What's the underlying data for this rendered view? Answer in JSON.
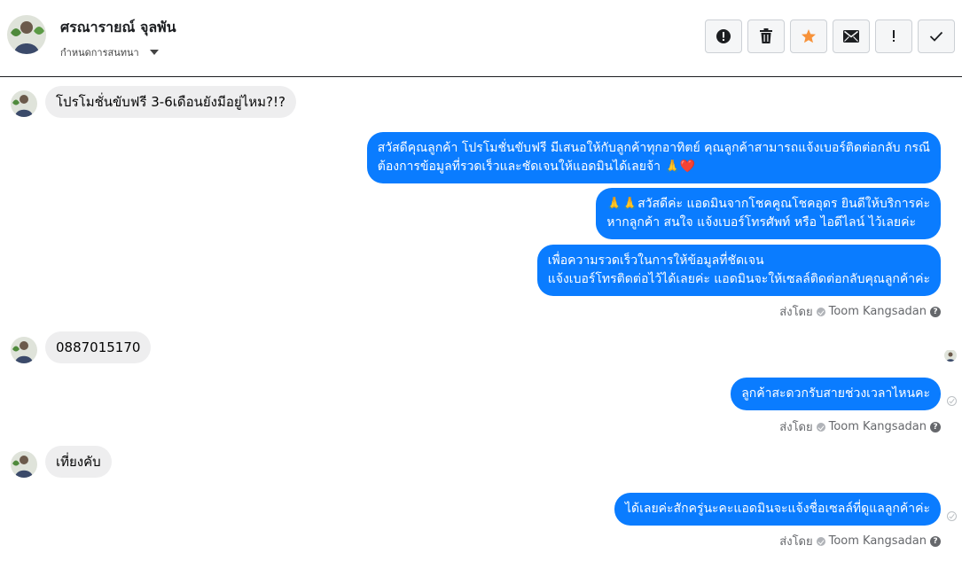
{
  "header": {
    "contact_name": "ศรณารายณ์ จุลพัน",
    "assign_label": "กำหนดการสนทนา",
    "toolbar": [
      {
        "name": "spam-button",
        "icon": "alert-circle-icon"
      },
      {
        "name": "delete-button",
        "icon": "trash-icon"
      },
      {
        "name": "star-button",
        "icon": "star-icon"
      },
      {
        "name": "mark-unread-button",
        "icon": "envelope-icon"
      },
      {
        "name": "follow-up-button",
        "icon": "exclamation-icon"
      },
      {
        "name": "mark-done-button",
        "icon": "checkmark-icon"
      }
    ],
    "accent_star": "#f7923a"
  },
  "messages": {
    "m1": "โปรโมชั่นขับฟรี 3-6เดือนยังมีอยู่ไหม?!?",
    "m2": [
      "สวัสดีคุณลูกค้า โปรโมชั่นขับฟรี มีเสนอให้กับลูกค้าทุกอาทิตย์ คุณลูกค้าสามารถแจ้งเบอร์ติดต่อกลับ กรณี",
      "ต้องการข้อมูลที่รวดเร็วและชัดเจนให้แอดมินได้เลยจ้า 🙏❤️"
    ],
    "m3": [
      "🙏🙏สวัสดีค่ะ แอดมินจากโชคคูณโชคอุดร ยินดีให้บริการค่ะ",
      "หากลูกค้า สนใจ แจ้งเบอร์โทรศัพท์ หรือ ไอดีไลน์  ไว้เลยค่ะ"
    ],
    "m4": [
      "เพื่อความรวดเร็วในการให้ข้อมูลที่ชัดเจน",
      "แจ้งเบอร์โทรติดต่อไว้ได้เลยค่ะ แอดมินจะให้เซลล์ติดต่อกลับคุณลูกค้าค่ะ"
    ],
    "m5": "0887015170",
    "m6": "ลูกค้าสะดวกรับสายช่วงเวลาไหนคะ",
    "m7": "เที่ยงคับ",
    "m8": "ได้เลยค่ะสักครู่นะคะแอดมินจะแจ้งชื่อเซลล์ที่ดูแลลูกค้าค่ะ"
  },
  "sent_by": {
    "prefix": "ส่งโดย",
    "agent": "Toom Kangsadan",
    "help": "?"
  },
  "colors": {
    "outgoing_bubble": "#0a7cff",
    "incoming_bubble": "#eeeeef"
  }
}
